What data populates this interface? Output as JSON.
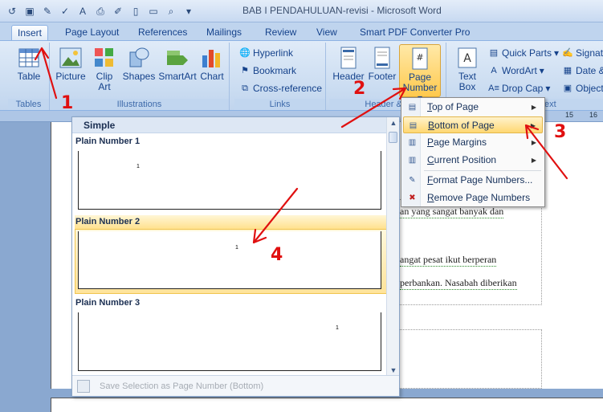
{
  "window": {
    "title": "BAB I PENDAHULUAN-revisi - Microsoft Word"
  },
  "quick_access": [
    "undo-icon",
    "save-icon",
    "new-icon",
    "spellcheck-icon",
    "font-icon",
    "print-icon",
    "edit-icon",
    "blank-icon",
    "open-icon",
    "print-preview-icon",
    "customize-icon"
  ],
  "tabs": [
    {
      "label": "Insert",
      "active": true
    },
    {
      "label": "Page Layout"
    },
    {
      "label": "References"
    },
    {
      "label": "Mailings"
    },
    {
      "label": "Review"
    },
    {
      "label": "View"
    },
    {
      "label": "Smart PDF Converter Pro"
    }
  ],
  "ribbon": {
    "tables": {
      "label": "Tables",
      "table_btn": "Table"
    },
    "illustrations": {
      "label": "Illustrations",
      "picture": "Picture",
      "clip_art_1": "Clip",
      "clip_art_2": "Art",
      "shapes": "Shapes",
      "smartart": "SmartArt",
      "chart": "Chart"
    },
    "links": {
      "label": "Links",
      "hyperlink": "Hyperlink",
      "bookmark": "Bookmark",
      "cross_reference": "Cross-reference"
    },
    "header_footer": {
      "label": "Header & F",
      "header": "Header",
      "footer": "Footer",
      "page_number_1": "Page",
      "page_number_2": "Number"
    },
    "text": {
      "label": "ext",
      "text_box_1": "Text",
      "text_box_2": "Box",
      "quick_parts": "Quick Parts",
      "wordart": "WordArt",
      "drop_cap": "Drop Cap",
      "signature": "Signat",
      "date": "Date &",
      "object": "Object"
    }
  },
  "ruler": {
    "tick_15": "15",
    "tick_16": "16"
  },
  "gallery": {
    "section": "Simple",
    "items": [
      {
        "label": "Plain Number 1",
        "preview_number": "1"
      },
      {
        "label": "Plain Number 2",
        "preview_number": "1"
      },
      {
        "label": "Plain Number 3",
        "preview_number": "1"
      }
    ],
    "footer": "Save Selection as Page Number (Bottom)"
  },
  "menu": {
    "items": [
      {
        "label": "Top of Page",
        "underline": "T",
        "rest": "op of Page"
      },
      {
        "label": "Bottom of Page",
        "underline": "B",
        "rest": "ottom of Page"
      },
      {
        "label": "Page Margins",
        "underline": "P",
        "rest": "age Margins"
      },
      {
        "label": "Current Position",
        "underline": "C",
        "rest": "urrent Position"
      },
      {
        "label": "Format Page Numbers...",
        "underline": "F",
        "rest": "ormat Page Numbers..."
      },
      {
        "label": "Remove Page Numbers",
        "underline": "R",
        "rest": "emove Page Numbers"
      }
    ]
  },
  "document": {
    "line1": "an yang sangat banyak dan",
    "line2": "angat   pesat   ikut   berperan",
    "line3": "perbankan. Nasabah diberikan"
  },
  "annotations": {
    "n1": "1",
    "n2": "2",
    "n3": "3",
    "n4": "4"
  },
  "colors": {
    "annotation_red": "#e01010",
    "highlight": "#ffd772",
    "ribbon": "#cadcf1"
  }
}
